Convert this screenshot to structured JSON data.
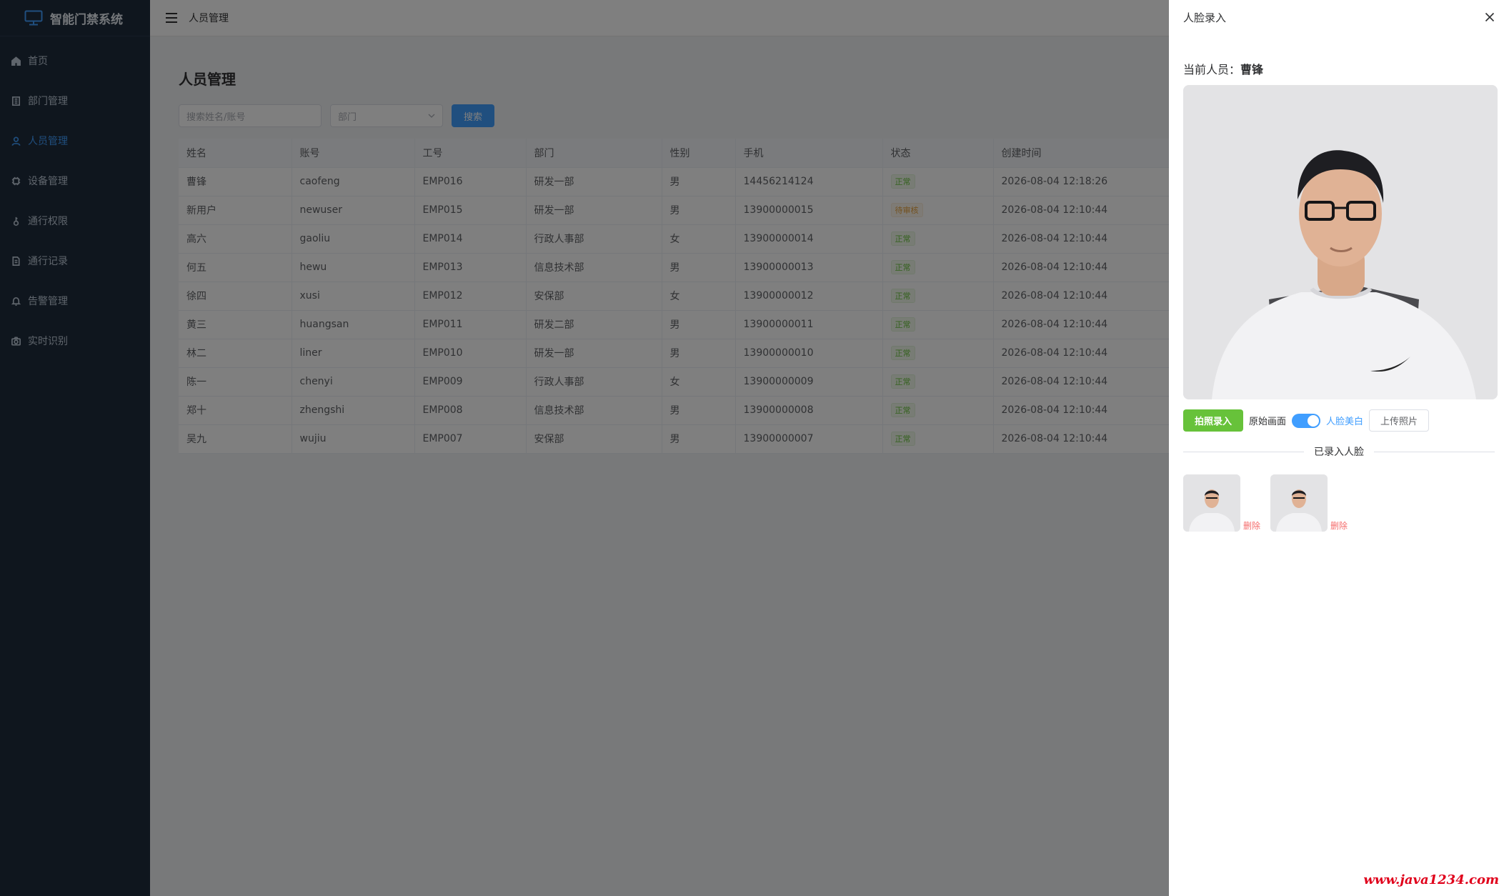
{
  "sidebar": {
    "brand": "智能门禁系统",
    "items": [
      {
        "label": "首页",
        "icon": "home-icon"
      },
      {
        "label": "部门管理",
        "icon": "building-icon"
      },
      {
        "label": "人员管理",
        "icon": "user-icon",
        "active": true
      },
      {
        "label": "设备管理",
        "icon": "device-icon"
      },
      {
        "label": "通行权限",
        "icon": "key-icon"
      },
      {
        "label": "通行记录",
        "icon": "document-icon"
      },
      {
        "label": "告警管理",
        "icon": "bell-icon"
      },
      {
        "label": "实时识别",
        "icon": "camera-icon"
      }
    ]
  },
  "header": {
    "breadcrumb": "人员管理"
  },
  "main": {
    "title": "人员管理",
    "search_placeholder": "搜索姓名/账号",
    "dept_placeholder": "部门",
    "search_button": "搜索",
    "columns": [
      "姓名",
      "账号",
      "工号",
      "部门",
      "性别",
      "手机",
      "状态",
      "创建时间"
    ],
    "rows": [
      [
        "曹锋",
        "caofeng",
        "EMP016",
        "研发一部",
        "男",
        "14456214124",
        "正常",
        "2026-08-04 12:18:26"
      ],
      [
        "新用户",
        "newuser",
        "EMP015",
        "研发一部",
        "男",
        "13900000015",
        "待审核",
        "2026-08-04 12:10:44"
      ],
      [
        "高六",
        "gaoliu",
        "EMP014",
        "行政人事部",
        "女",
        "13900000014",
        "正常",
        "2026-08-04 12:10:44"
      ],
      [
        "何五",
        "hewu",
        "EMP013",
        "信息技术部",
        "男",
        "13900000013",
        "正常",
        "2026-08-04 12:10:44"
      ],
      [
        "徐四",
        "xusi",
        "EMP012",
        "安保部",
        "女",
        "13900000012",
        "正常",
        "2026-08-04 12:10:44"
      ],
      [
        "黄三",
        "huangsan",
        "EMP011",
        "研发二部",
        "男",
        "13900000011",
        "正常",
        "2026-08-04 12:10:44"
      ],
      [
        "林二",
        "liner",
        "EMP010",
        "研发一部",
        "男",
        "13900000010",
        "正常",
        "2026-08-04 12:10:44"
      ],
      [
        "陈一",
        "chenyi",
        "EMP009",
        "行政人事部",
        "女",
        "13900000009",
        "正常",
        "2026-08-04 12:10:44"
      ],
      [
        "郑十",
        "zhengshi",
        "EMP008",
        "信息技术部",
        "男",
        "13900000008",
        "正常",
        "2026-08-04 12:10:44"
      ],
      [
        "吴九",
        "wujiu",
        "EMP007",
        "安保部",
        "男",
        "13900000007",
        "正常",
        "2026-08-04 12:10:44"
      ]
    ]
  },
  "drawer": {
    "title": "人脸录入",
    "current_label": "当前人员：",
    "current_name": "曹锋",
    "capture_button": "拍照录入",
    "switch_off_label": "原始画面",
    "switch_on_label": "人脸美白",
    "switch_on": true,
    "upload_button": "上传照片",
    "enrolled_title": "已录入人脸",
    "faces": [
      {
        "delete_label": "删除"
      },
      {
        "delete_label": "删除"
      }
    ]
  },
  "watermark": "www.java1234.com",
  "colors": {
    "sidebar_bg": "#1f2d3d",
    "accent": "#409eff",
    "success": "#67c23a",
    "warning": "#e6a23c",
    "danger": "#f56c6c"
  }
}
